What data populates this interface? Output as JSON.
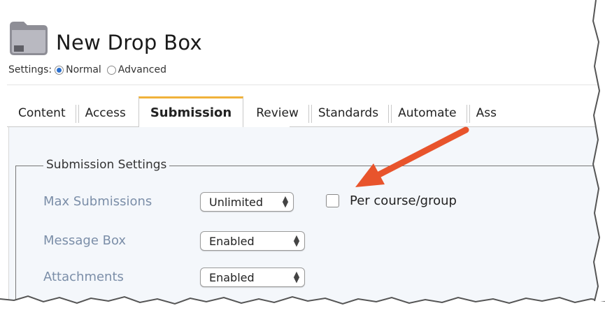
{
  "header": {
    "title": "New Drop Box",
    "settings_label": "Settings:",
    "mode_normal": "Normal",
    "mode_advanced": "Advanced",
    "selected_mode": "Normal"
  },
  "tabs": [
    {
      "label": "Content",
      "active": false
    },
    {
      "label": "Access",
      "active": false
    },
    {
      "label": "Submission",
      "active": true
    },
    {
      "label": "Review",
      "active": false
    },
    {
      "label": "Standards",
      "active": false
    },
    {
      "label": "Automate",
      "active": false
    },
    {
      "label": "Ass",
      "active": false
    }
  ],
  "submission_settings": {
    "legend": "Submission Settings",
    "fields": [
      {
        "label": "Max Submissions",
        "value": "Unlimited"
      },
      {
        "label": "Message Box",
        "value": "Enabled"
      },
      {
        "label": "Attachments",
        "value": "Enabled"
      }
    ],
    "per_course_group_label": "Per course/group",
    "per_course_group_checked": false
  },
  "colors": {
    "active_tab_accent": "#f0b23a",
    "field_label": "#7b8ea8",
    "arrow": "#e8542c",
    "radio_selected": "#2a6fce"
  }
}
